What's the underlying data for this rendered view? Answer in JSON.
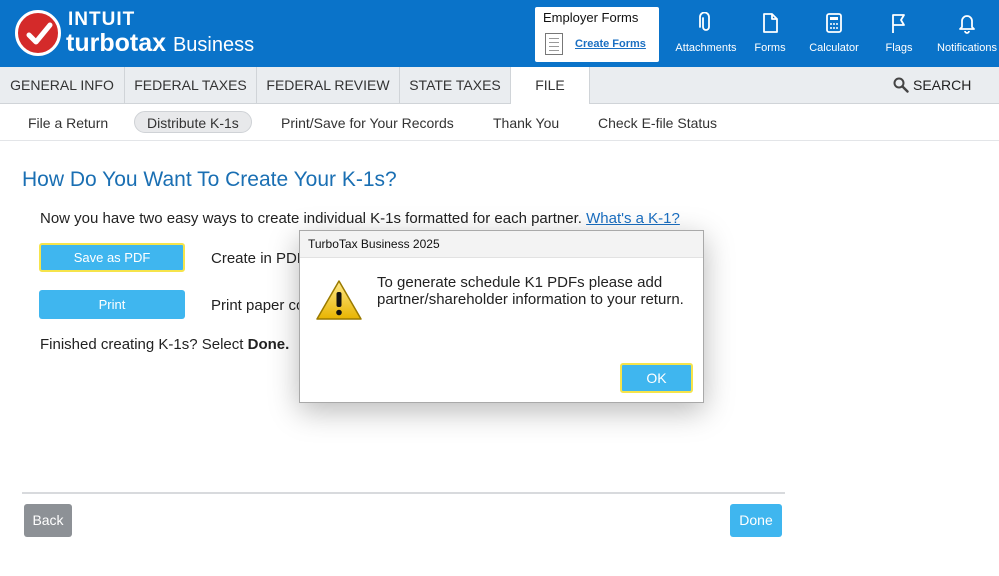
{
  "brand": {
    "company": "INTUIT",
    "product": "turbotax",
    "edition": "Business"
  },
  "employer_forms": {
    "title": "Employer Forms",
    "link": "Create Forms"
  },
  "toolbar": {
    "items": [
      {
        "label": "Attachments",
        "icon": "paperclip-icon"
      },
      {
        "label": "Forms",
        "icon": "document-icon"
      },
      {
        "label": "Calculator",
        "icon": "calculator-icon"
      },
      {
        "label": "Flags",
        "icon": "flag-icon"
      },
      {
        "label": "Notifications",
        "icon": "bell-icon"
      }
    ]
  },
  "nav": {
    "tabs": [
      {
        "label": "GENERAL INFO"
      },
      {
        "label": "FEDERAL TAXES"
      },
      {
        "label": "FEDERAL REVIEW"
      },
      {
        "label": "STATE TAXES"
      },
      {
        "label": "FILE",
        "active": true
      }
    ],
    "search_label": "SEARCH"
  },
  "subnav": {
    "items": [
      {
        "label": "File a Return"
      },
      {
        "label": "Distribute K-1s",
        "active": true
      },
      {
        "label": "Print/Save for Your Records"
      },
      {
        "label": "Thank You"
      },
      {
        "label": "Check E-file Status"
      }
    ]
  },
  "main": {
    "title": "How Do You Want To Create Your K-1s?",
    "intro": "Now you have two easy ways to create individual K-1s formatted for each partner.",
    "intro_link": "What's a K-1?",
    "save_pdf_label": "Save as PDF",
    "save_pdf_desc": "Create in PDF",
    "print_label": "Print",
    "print_desc": "Print paper co",
    "finished_prefix": "Finished creating K-1s? Select ",
    "finished_bold": "Done.",
    "back_label": "Back",
    "done_label": "Done"
  },
  "dialog": {
    "title": "TurboTax Business 2025",
    "message": "To generate schedule K1 PDFs please add partner/shareholder information to your return.",
    "ok_label": "OK",
    "icon": "warning-icon"
  },
  "colors": {
    "header_blue": "#0a73c9",
    "button_blue": "#3fb6ef",
    "title_blue": "#1a6fb3",
    "focus_yellow": "#f6e44b",
    "logo_red": "#d42a2a"
  }
}
